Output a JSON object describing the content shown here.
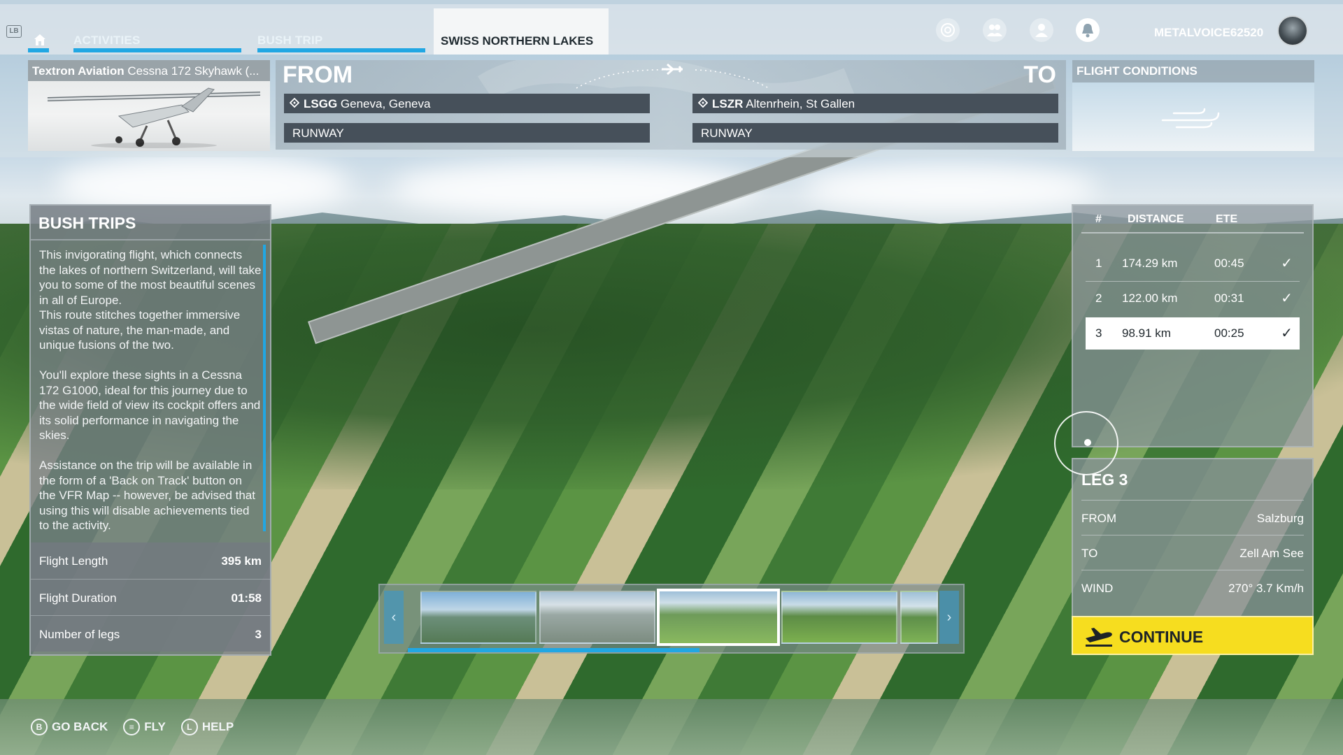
{
  "topbar": {
    "lb_badge": "LB",
    "tabs": [
      {
        "label": "ACTIVITIES"
      },
      {
        "label": "BUSH TRIP"
      },
      {
        "label": "SWISS NORTHERN LAKES"
      }
    ],
    "username": "METALVOICE62520"
  },
  "aircraft": {
    "brand": "Textron Aviation",
    "model": "Cessna 172 Skyhawk (..."
  },
  "route": {
    "from_label": "FROM",
    "to_label": "TO",
    "departure": {
      "icao": "LSGG",
      "name": "Geneva, Geneva",
      "runway": "RUNWAY"
    },
    "arrival": {
      "icao": "LSZR",
      "name": "Altenrhein, St Gallen",
      "runway": "RUNWAY"
    }
  },
  "conditions": {
    "title": "FLIGHT CONDITIONS"
  },
  "bush_trips": {
    "title": "BUSH TRIPS",
    "description": "This invigorating flight, which connects the lakes of northern Switzerland, will take you to some of the most beautiful scenes in all of Europe.\nThis route stitches together immersive vistas of nature, the man-made, and unique fusions of the two.\n\nYou'll explore these sights in a Cessna 172 G1000, ideal for this journey due to the wide field of view its cockpit offers and its solid performance in navigating the skies.\n\nAssistance on the trip will be available in the form of a 'Back on Track' button on the VFR Map -- however, be advised that using this will disable achievements tied to the activity.",
    "stats": [
      {
        "label": "Flight Length",
        "value": "395 km"
      },
      {
        "label": "Flight Duration",
        "value": "01:58"
      },
      {
        "label": "Number of legs",
        "value": "3"
      }
    ]
  },
  "legs": {
    "headers": {
      "num": "#",
      "distance": "DISTANCE",
      "ete": "ETE"
    },
    "rows": [
      {
        "num": "1",
        "distance": "174.29 km",
        "ete": "00:45",
        "done": "✓"
      },
      {
        "num": "2",
        "distance": "122.00 km",
        "ete": "00:31",
        "done": "✓"
      },
      {
        "num": "3",
        "distance": "98.91 km",
        "ete": "00:25",
        "done": "✓"
      }
    ],
    "selected_index": 2
  },
  "leg_detail": {
    "title": "LEG 3",
    "rows": [
      {
        "label": "FROM",
        "value": "Salzburg"
      },
      {
        "label": "TO",
        "value": "Zell Am See"
      },
      {
        "label": "WIND",
        "value": "270° 3.7 Km/h"
      }
    ]
  },
  "continue": {
    "label": "CONTINUE"
  },
  "carousel": {
    "thumbnails": 5,
    "selected_index": 2,
    "progress": 0.55
  },
  "hints": [
    {
      "glyph": "B",
      "label": "GO BACK"
    },
    {
      "glyph": "≡",
      "label": "FLY"
    },
    {
      "glyph": "L",
      "label": "HELP"
    }
  ],
  "colors": {
    "accent_blue": "#21a7e3",
    "continue_yellow": "#f6dd1f",
    "panel_gray": "#46505a"
  }
}
